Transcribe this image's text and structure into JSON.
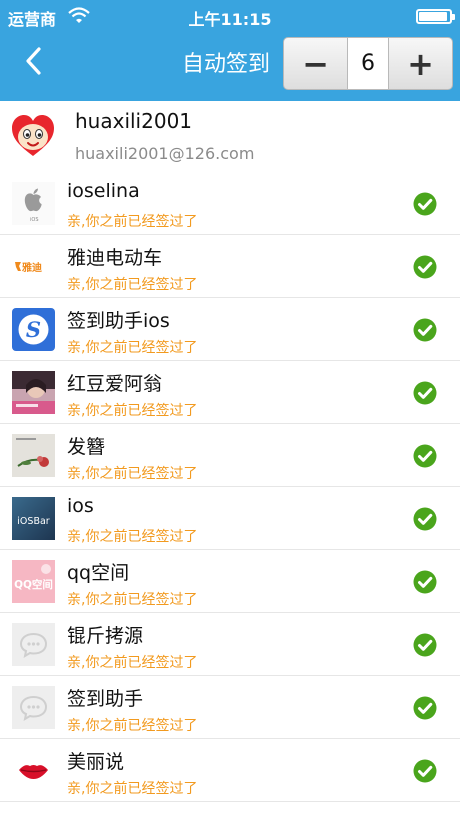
{
  "status_bar": {
    "carrier": "运营商",
    "time": "上午11:15",
    "battery_level": 0.95
  },
  "nav": {
    "title": "自动签到"
  },
  "stepper": {
    "minus": "−",
    "value": "6",
    "plus": "+"
  },
  "account": {
    "name": "huaxili2001",
    "email": "huaxili2001@126.com"
  },
  "apps": [
    {
      "name": "ioselina",
      "status": "亲,你之前已经签过了",
      "icon": "apple-logo-icon",
      "badge": "iOS"
    },
    {
      "name": "雅迪电动车",
      "status": "亲,你之前已经签过了",
      "icon": "yadea-logo-icon",
      "badge": "雅迪"
    },
    {
      "name": "签到助手ios",
      "status": "亲,你之前已经签过了",
      "icon": "s-logo-icon",
      "badge": "S"
    },
    {
      "name": "红豆爱阿翁",
      "status": "亲,你之前已经签过了",
      "icon": "photo-icon"
    },
    {
      "name": "发簪",
      "status": "亲,你之前已经签过了",
      "icon": "flower-photo-icon"
    },
    {
      "name": "ios",
      "status": "亲,你之前已经签过了",
      "icon": "iosbar-logo-icon",
      "badge": "iOSBar"
    },
    {
      "name": "qq空间",
      "status": "亲,你之前已经签过了",
      "icon": "qq-space-icon",
      "badge": "QQ空间"
    },
    {
      "name": "锟斤拷源",
      "status": "亲,你之前已经签过了",
      "icon": "placeholder-chat-icon"
    },
    {
      "name": "签到助手",
      "status": "亲,你之前已经签过了",
      "icon": "placeholder-chat-icon"
    },
    {
      "name": "美丽说",
      "status": "亲,你之前已经签过了",
      "icon": "lips-icon"
    }
  ],
  "colors": {
    "header": "#39a4df",
    "status_text": "#f29a1f",
    "check": "#4aa51c"
  }
}
